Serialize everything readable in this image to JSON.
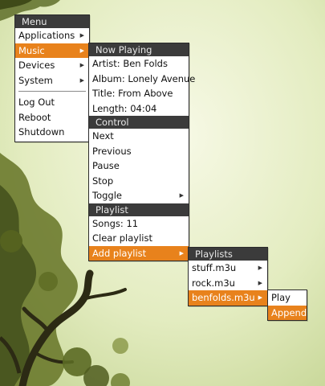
{
  "colors": {
    "highlight": "#e8821c",
    "header_bg": "#3b3b3b",
    "menu_bg": "#ffffff"
  },
  "main_menu": {
    "title": "Menu",
    "items": [
      {
        "label": "Applications",
        "submenu": true,
        "active": false
      },
      {
        "label": "Music",
        "submenu": true,
        "active": true
      },
      {
        "label": "Devices",
        "submenu": true,
        "active": false
      },
      {
        "label": "System",
        "submenu": true,
        "active": false
      }
    ],
    "actions": [
      {
        "label": "Log Out"
      },
      {
        "label": "Reboot"
      },
      {
        "label": "Shutdown"
      }
    ]
  },
  "music_menu": {
    "now_playing": {
      "title": "Now Playing",
      "artist": "Artist: Ben Folds",
      "album": "Album: Lonely Avenue",
      "track": "Title:  From Above",
      "length": "Length:  04:04"
    },
    "control": {
      "title": "Control",
      "next": "Next",
      "previous": "Previous",
      "pause": "Pause",
      "stop": "Stop",
      "toggle": "Toggle"
    },
    "playlist": {
      "title": "Playlist",
      "songs": "Songs: 11",
      "clear": "Clear playlist",
      "add": "Add playlist"
    }
  },
  "playlists_menu": {
    "title": "Playlists",
    "items": [
      {
        "label": "stuff.m3u",
        "active": false
      },
      {
        "label": "rock.m3u",
        "active": false
      },
      {
        "label": "benfolds.m3u",
        "active": true
      }
    ]
  },
  "action_menu": {
    "items": [
      {
        "label": "Play",
        "active": false
      },
      {
        "label": "Append",
        "active": true
      }
    ]
  },
  "icons": {
    "submenu_arrow": "triangle-right-icon"
  }
}
